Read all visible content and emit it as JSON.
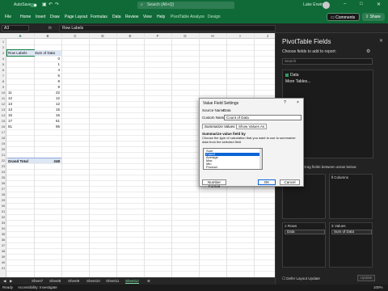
{
  "titlebar": {
    "autosave_label": "AutoSave",
    "autosave_state": "On",
    "search_placeholder": "Search (Alt+Q)",
    "user_name": "Luke Erwin"
  },
  "ribbon": {
    "tabs": [
      "File",
      "Home",
      "Insert",
      "Draw",
      "Page Layout",
      "Formulas",
      "Data",
      "Review",
      "View",
      "Help"
    ],
    "contextual_tabs": [
      "PivotTable Analyze",
      "Design"
    ],
    "comments_label": "Comments",
    "share_label": "Share"
  },
  "formula_bar": {
    "name_box": "A3",
    "fx": "fx",
    "value": "Row Labels"
  },
  "grid": {
    "columns": [
      "A",
      "B",
      "C",
      "D",
      "E",
      "F",
      "G",
      "H",
      "I",
      "J"
    ],
    "selected_column": "A",
    "rows": [
      "1",
      "2",
      "3",
      "4",
      "5",
      "6",
      "7",
      "8",
      "9",
      "10",
      "11",
      "12",
      "13",
      "14",
      "15",
      "16",
      "17",
      "18",
      "19",
      "20",
      "21",
      "22",
      "23",
      "24",
      "25",
      "26",
      "27",
      "28",
      "29",
      "30",
      "31",
      "32",
      "33",
      "34",
      "35",
      "36",
      "37",
      "38",
      "39",
      "40",
      "41"
    ],
    "pivot": {
      "header_label": "Row Labels",
      "header_value": "Sum of Data",
      "rows": [
        {
          "label": "",
          "value": "0"
        },
        {
          "label": "",
          "value": "1"
        },
        {
          "label": "",
          "value": "4"
        },
        {
          "label": "",
          "value": "6"
        },
        {
          "label": "",
          "value": "8"
        },
        {
          "label": "",
          "value": "9"
        },
        {
          "label": "",
          "value": "22"
        },
        {
          "label": "",
          "value": "12"
        },
        {
          "label": "",
          "value": "12"
        },
        {
          "label": "",
          "value": "15"
        },
        {
          "label": "",
          "value": "16"
        },
        {
          "label": "",
          "value": "51"
        },
        {
          "label": "",
          "value": "95"
        }
      ],
      "labels_visible": [
        "",
        "",
        "",
        "",
        "",
        "",
        "11",
        "12",
        "13",
        "13",
        "15",
        "17",
        "51"
      ],
      "total_label": "Grand Total",
      "total_value": "248"
    }
  },
  "sheet_tabs": {
    "tabs": [
      "Sheet7",
      "Sheet8",
      "Sheet9",
      "Sheet10",
      "Sheet11",
      "Sheet12"
    ],
    "active": "Sheet12"
  },
  "status_bar": {
    "ready": "Ready",
    "accessibility": "Accessibility: Investigate",
    "zoom": "100%"
  },
  "pivot_pane": {
    "title": "PivotTable Fields",
    "subtitle": "Choose fields to add to report:",
    "search_placeholder": "Search",
    "fields": [
      "Data",
      "More Tables..."
    ],
    "areas_label": "Drag fields between areas below:",
    "filters_label": "Filters",
    "columns_label": "Columns",
    "rows_label": "Rows",
    "values_label": "Values",
    "rows_chip": "Data",
    "values_chip": "Sum of Data",
    "defer_label": "Defer Layout Update",
    "update_label": "Update"
  },
  "dialog": {
    "title": "Value Field Settings",
    "help": "?",
    "close": "×",
    "source_name_label": "Source Name:",
    "source_name_value": "Data",
    "custom_name_label": "Custom Name:",
    "custom_name_value": "Count of Data",
    "tab_summarize": "Summarize Values By",
    "tab_show": "Show Values As",
    "section_label": "Summarize value field by",
    "description": "Choose the type of calculation that you want to use to summarize data from the selected field",
    "options": [
      "Sum",
      "Count",
      "Average",
      "Max",
      "Min",
      "Product"
    ],
    "selected_option": "Count",
    "number_format_label": "Number Format",
    "ok_label": "OK",
    "cancel_label": "Cancel"
  }
}
